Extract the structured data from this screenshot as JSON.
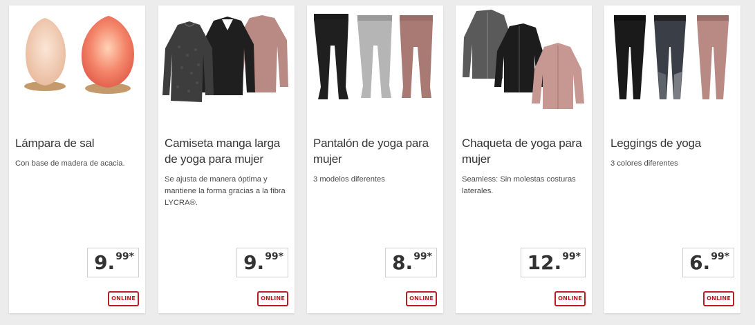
{
  "products": [
    {
      "title": "Lámpara de sal",
      "description": "Con base de madera de acacia.",
      "price_int": "9.",
      "price_dec": "99*",
      "badge": "ONLINE",
      "image_icon": "salt-lamp-image"
    },
    {
      "title": "Camiseta manga larga de yoga para mujer",
      "description": "Se ajusta de manera óptima y mantiene la forma gracias a la fibra LYCRA®.",
      "price_int": "9.",
      "price_dec": "99*",
      "badge": "ONLINE",
      "image_icon": "long-sleeve-shirts-image"
    },
    {
      "title": "Pantalón de yoga para mujer",
      "description": "3 modelos diferentes",
      "price_int": "8.",
      "price_dec": "99*",
      "badge": "ONLINE",
      "image_icon": "yoga-pants-image"
    },
    {
      "title": "Chaqueta de yoga para mujer",
      "description": "Seamless: Sin molestas costuras laterales.",
      "price_int": "12.",
      "price_dec": "99*",
      "badge": "ONLINE",
      "image_icon": "yoga-jackets-image"
    },
    {
      "title": "Leggings de yoga",
      "description": "3 colores diferentes",
      "price_int": "6.",
      "price_dec": "99*",
      "badge": "ONLINE",
      "image_icon": "yoga-leggings-image"
    }
  ],
  "colors": {
    "badge_red": "#b61e24",
    "card_bg": "#ffffff",
    "page_bg": "#ececec",
    "rose": "#b98a84",
    "dark_grey": "#333333",
    "black": "#1a1a1a",
    "light_grey": "#b9b9b9"
  }
}
